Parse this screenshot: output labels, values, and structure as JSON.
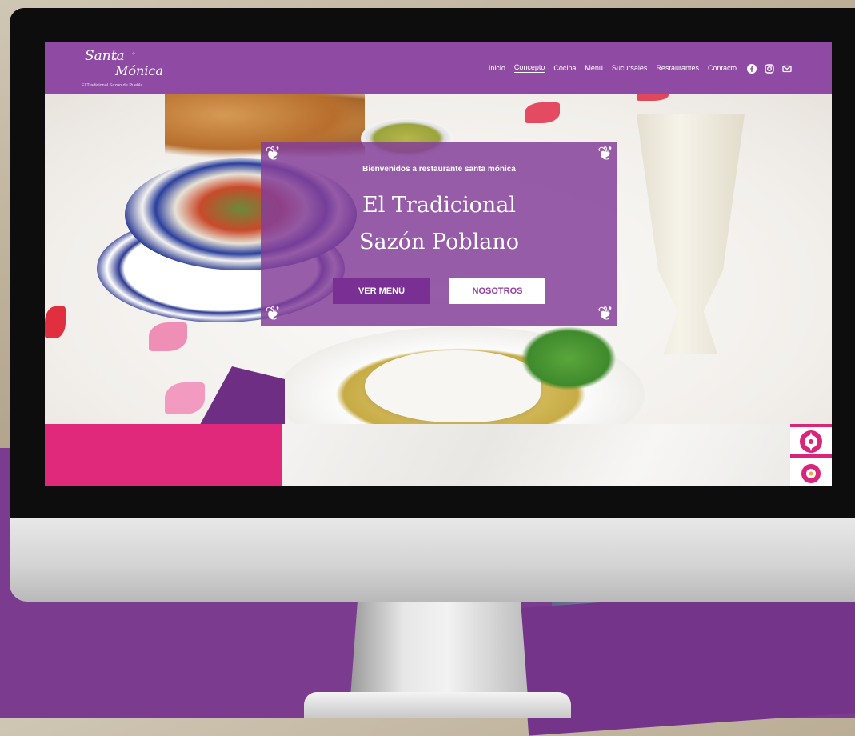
{
  "site": {
    "logo_line1": "Santa",
    "logo_line2": "Mónica",
    "logo_tagline": "El Tradicional Sazón de Puebla"
  },
  "nav": {
    "items": [
      {
        "label": "Inicio",
        "active": false
      },
      {
        "label": "Concepto",
        "active": true
      },
      {
        "label": "Cocina",
        "active": false
      },
      {
        "label": "Menú",
        "active": false
      },
      {
        "label": "Sucursales",
        "active": false
      },
      {
        "label": "Restaurantes",
        "active": false
      },
      {
        "label": "Contacto",
        "active": false
      }
    ],
    "social_icons": [
      "facebook-icon",
      "instagram-icon",
      "mail-icon"
    ]
  },
  "hero": {
    "kicker": "Bienvenidos a restaurante santa mónica",
    "title_line1": "El Tradicional",
    "title_line2": "Sazón Poblano",
    "button_primary": "VER MENÚ",
    "button_secondary": "NOSOTROS"
  },
  "colors": {
    "brand_purple": "#8f4aa3",
    "card_purple": "#833e99",
    "accent_pink": "#e0297b",
    "background_purple": "#7b3b8f"
  }
}
